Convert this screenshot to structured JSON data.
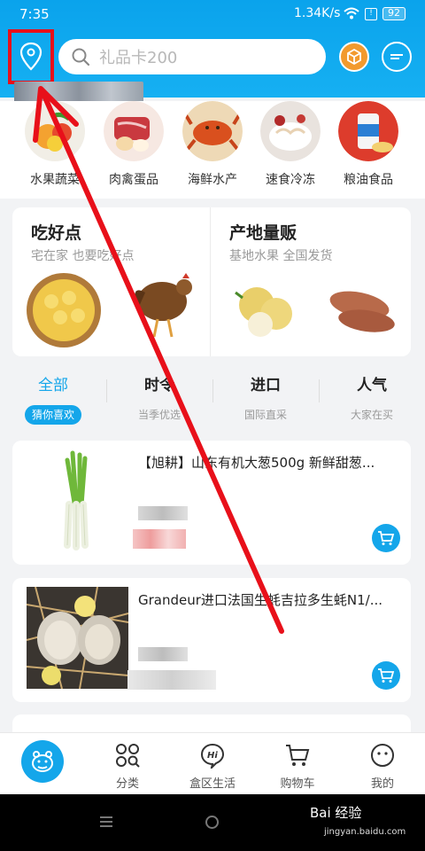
{
  "status": {
    "time": "7:35",
    "network": "1.34K/s",
    "battery": "92"
  },
  "search": {
    "placeholder": "礼品卡200"
  },
  "categories": [
    {
      "label": "水果蔬菜"
    },
    {
      "label": "肉禽蛋品"
    },
    {
      "label": "海鲜水产"
    },
    {
      "label": "速食冷冻"
    },
    {
      "label": "粮油食品"
    }
  ],
  "promo": {
    "left": {
      "title": "吃好点",
      "subtitle": "宅在家 也要吃好点"
    },
    "right": {
      "title": "产地量贩",
      "subtitle": "基地水果 全国发货"
    }
  },
  "tabs": [
    {
      "title": "全部",
      "subtitle": "猜你喜欢"
    },
    {
      "title": "时令",
      "subtitle": "当季优选"
    },
    {
      "title": "进口",
      "subtitle": "国际直采"
    },
    {
      "title": "人气",
      "subtitle": "大家在买"
    }
  ],
  "products": [
    {
      "name": "【旭耕】山东有机大葱500g 新鲜甜葱..."
    },
    {
      "name": "Grandeur进口法国生蚝吉拉多生蚝N1/..."
    }
  ],
  "bottom_nav": [
    {
      "label": ""
    },
    {
      "label": "分类"
    },
    {
      "label": "盒区生活"
    },
    {
      "label": "购物车"
    },
    {
      "label": "我的"
    }
  ],
  "watermark": {
    "main": "Bai 经验",
    "sub": "jingyan.baidu.com"
  },
  "colors": {
    "brand_blue": "#14a6ea",
    "highlight_red": "#e8101a",
    "orange": "#f29a2e"
  }
}
